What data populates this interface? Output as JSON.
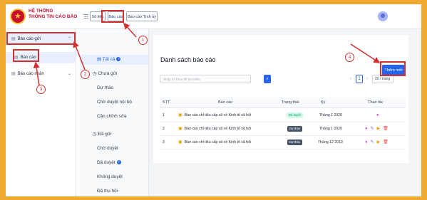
{
  "brand": {
    "line1": "HỆ THỐNG",
    "line2": "THÔNG TIN CÁO BÁO"
  },
  "top_tabs": [
    "Số liệu",
    "Báo cáo",
    "Báo cáo Tính ủy"
  ],
  "sidebar": {
    "items": [
      {
        "label": "Báo cáo gửi",
        "selected": true,
        "icon": "list-icon",
        "chevron": "chevron-up-icon"
      },
      {
        "label": "Báo cáo",
        "selected": true,
        "icon": "list-icon"
      },
      {
        "label": "Báo cáo nhận",
        "selected": false,
        "icon": "list-icon",
        "chevron": "chevron-down-icon"
      }
    ]
  },
  "subnav": {
    "all_label": "Tất cả",
    "pending_header": "Chưa gửi",
    "pending_items": [
      "Dự thảo",
      "Chờ duyệt nội bộ",
      "Cần chỉnh sửa"
    ],
    "sent_header": "Đã gửi",
    "sent_items": [
      "Chờ duyệt",
      "Đã duyệt",
      "Không duyệt",
      "Đã thu hồi"
    ]
  },
  "main": {
    "title": "Danh sách báo cáo",
    "add_button": "Thêm mới",
    "search_placeholder": "Nhập từ khóa để tìm kiếm",
    "page_number": "1",
    "page_size": "20 / trang"
  },
  "table": {
    "headers": {
      "stt": "STT",
      "bao_cao": "Báo cáo",
      "trang_thai": "Trạng thái",
      "ky": "Kỳ",
      "thao_tac": "Thao tác"
    },
    "rows": [
      {
        "stt": "1",
        "name": "Báo cáo chỉ tiêu cấp xã về Kinh tế xã hội",
        "status": "Đã duyệt",
        "status_color": "#059669",
        "period": "Tháng 1 2020",
        "actions": [
          "view-icon"
        ]
      },
      {
        "stt": "2",
        "name": "Báo cáo chỉ tiêu cấp xã về Kinh tế xã hội",
        "status": "Dự thảo",
        "status_color": "#475569",
        "period": "Tháng 1 2020",
        "actions": [
          "view-icon",
          "edit-icon",
          "send-icon",
          "delete-icon"
        ]
      },
      {
        "stt": "3",
        "name": "Báo cáo chỉ tiêu cấp xã về Kinh tế xã hội",
        "status": "Dự thảo",
        "status_color": "#475569",
        "period": "Tháng 12 2019",
        "actions": [
          "view-icon",
          "edit-icon",
          "send-icon",
          "delete-icon"
        ]
      }
    ]
  },
  "annotations": {
    "markers": [
      "1",
      "2",
      "3",
      "4"
    ],
    "highlight_color": "#d32f2f"
  },
  "colors": {
    "background_frame": "#f0a833",
    "accent": "#2563eb",
    "brand_red": "#c8102e"
  }
}
